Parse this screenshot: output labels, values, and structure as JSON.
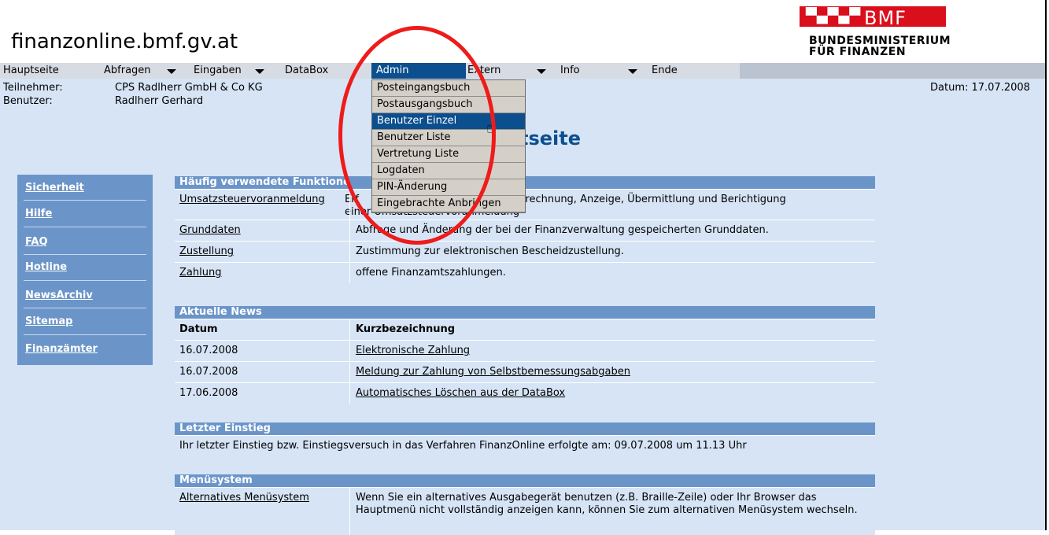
{
  "site_title": "finanzonline.bmf.gv.at",
  "logo": {
    "badge": "BMF",
    "line1": "BUNDESMINISTERIUM",
    "line2": "FÜR FINANZEN"
  },
  "menu": {
    "hauptseite": "Hauptseite",
    "abfragen": "Abfragen",
    "eingaben": "Eingaben",
    "databox": "DataBox",
    "admin": "Admin",
    "extern": "Extern",
    "info": "Info",
    "ende": "Ende"
  },
  "admin_dropdown": [
    "Posteingangsbuch",
    "Postausgangsbuch",
    "Benutzer Einzel",
    "Benutzer Liste",
    "Vertretung Liste",
    "Logdaten",
    "PIN-Änderung",
    "Eingebrachte Anbringen"
  ],
  "info": {
    "teilnehmer_label": "Teilnehmer:",
    "teilnehmer_value": "CPS Radlherr GmbH & Co KG",
    "benutzer_label": "Benutzer:",
    "benutzer_value": "Radlherr Gerhard",
    "datum": "Datum: 17.07.2008"
  },
  "page_heading": "tseite",
  "sidenav": [
    "Sicherheit",
    "Hilfe",
    "FAQ",
    "Hotline",
    "NewsArchiv",
    "Sitemap",
    "Finanzämter"
  ],
  "haeufig": {
    "title": "Häufig verwendete Funktione",
    "rows": [
      {
        "link": "Umsatzsteuervoranmeldung",
        "desc_a": "Erf",
        "desc_b": "berechnung, Anzeige, Übermittlung und Berichtigung",
        "desc_c": "einer Umsatzsteuervoranmeldung"
      },
      {
        "link": "Grunddaten",
        "desc": "Abfrage und Änderung der bei der Finanzverwaltung gespeicherten Grunddaten."
      },
      {
        "link": "Zustellung",
        "desc": "Zustimmung zur elektronischen Bescheidzustellung."
      },
      {
        "link": "Zahlung",
        "desc": "offene Finanzamtszahlungen."
      }
    ]
  },
  "news": {
    "title": "Aktuelle News",
    "col_datum": "Datum",
    "col_kurz": "Kurzbezeichnung",
    "rows": [
      {
        "date": "16.07.2008",
        "text": "Elektronische Zahlung"
      },
      {
        "date": "16.07.2008",
        "text": "Meldung zur Zahlung von Selbstbemessungsabgaben"
      },
      {
        "date": "17.06.2008",
        "text": "Automatisches Löschen aus der DataBox"
      }
    ]
  },
  "letzter": {
    "title": "Letzter Einstieg",
    "text": "Ihr letzter Einstieg bzw. Einstiegsversuch in das Verfahren FinanzOnline erfolgte am: 09.07.2008 um 11.13 Uhr"
  },
  "menuesystem": {
    "title": "Menüsystem",
    "link": "Alternatives Menüsystem",
    "desc": "Wenn Sie ein alternatives Ausgabegerät benutzen (z.B. Braille-Zeile) oder Ihr Browser das Hauptmenü nicht vollständig anzeigen kann, können Sie zum alternativen Menüsystem wechseln."
  },
  "colors": {
    "accent": "#0c4f8e",
    "section": "#6b95c9",
    "row": "#d6e4f5",
    "brand": "#d90f1c",
    "annotation": "#ee1b1b"
  }
}
